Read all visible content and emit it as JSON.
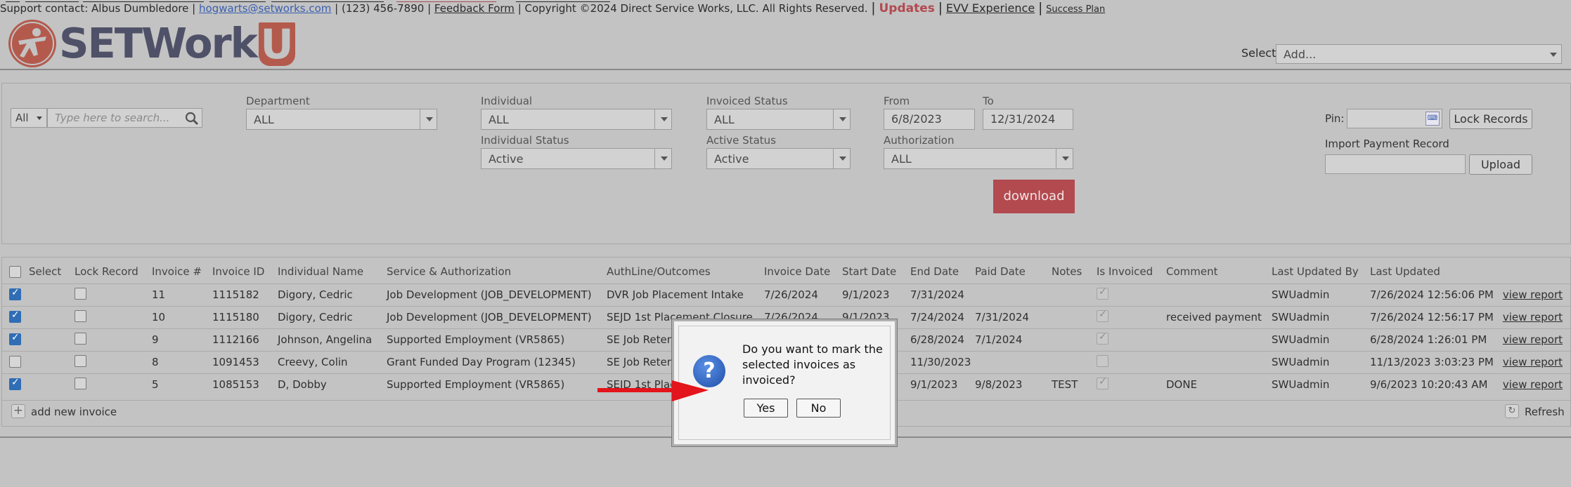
{
  "brand": {
    "logo_text": "SETWorks",
    "logo_u": "U",
    "colors": {
      "brand_red": "#b35a4d",
      "brand_slate": "#4f5168",
      "download_bg": "#b24a50"
    }
  },
  "header": {
    "select_label": "Select:",
    "select_value": "Add..."
  },
  "filters": {
    "search_scope": "All",
    "search_placeholder": "Type here to search...",
    "department": {
      "label": "Department",
      "value": "ALL"
    },
    "individual": {
      "label": "Individual",
      "value": "ALL"
    },
    "individual_status": {
      "label": "Individual Status",
      "value": "Active"
    },
    "invoiced_status": {
      "label": "Invoiced Status",
      "value": "ALL"
    },
    "active_status": {
      "label": "Active Status",
      "value": "Active"
    },
    "from": {
      "label": "From",
      "value": "6/8/2023"
    },
    "to": {
      "label": "To",
      "value": "12/31/2024"
    },
    "authorization": {
      "label": "Authorization",
      "value": "ALL"
    },
    "download_label": "download",
    "pin_label": "Pin:",
    "lock_records_label": "Lock Records",
    "import_label": "Import Payment Record",
    "upload_label": "Upload"
  },
  "grid": {
    "headers": [
      "Select",
      "Lock Record",
      "Invoice #",
      "Invoice ID",
      "Individual Name",
      "Service & Authorization",
      "AuthLine/Outcomes",
      "Invoice Date",
      "Start Date",
      "End Date",
      "Paid Date",
      "Notes",
      "Is Invoiced",
      "Comment",
      "Last Updated By",
      "Last Updated"
    ],
    "rows": [
      {
        "selected": true,
        "locked": false,
        "invoice_no": "11",
        "invoice_id": "1115182",
        "name": "Digory, Cedric",
        "service": "Job Development (JOB_DEVELOPMENT)",
        "authline": "DVR Job Placement Intake",
        "invoice_date": "7/26/2024",
        "start": "9/1/2023",
        "end": "7/31/2024",
        "paid": "",
        "notes": "",
        "invoiced": true,
        "comment": "",
        "updated_by": "SWUadmin",
        "updated": "7/26/2024 12:56:06 PM",
        "link": "view report"
      },
      {
        "selected": true,
        "locked": false,
        "invoice_no": "10",
        "invoice_id": "1115180",
        "name": "Digory, Cedric",
        "service": "Job Development (JOB_DEVELOPMENT)",
        "authline": "SEJD 1st Placement Closure",
        "invoice_date": "7/26/2024",
        "start": "9/1/2023",
        "end": "7/24/2024",
        "paid": "7/31/2024",
        "notes": "",
        "invoiced": true,
        "comment": "received payment",
        "updated_by": "SWUadmin",
        "updated": "7/26/2024 12:56:17 PM",
        "link": "view report"
      },
      {
        "selected": true,
        "locked": false,
        "invoice_no": "9",
        "invoice_id": "1112166",
        "name": "Johnson, Angelina",
        "service": "Supported Employment (VR5865)",
        "authline": "SE Job Retent",
        "invoice_date": "",
        "start": "",
        "end": "6/28/2024",
        "paid": "7/1/2024",
        "notes": "",
        "invoiced": true,
        "comment": "",
        "updated_by": "SWUadmin",
        "updated": "6/28/2024 1:26:01 PM",
        "link": "view report"
      },
      {
        "selected": false,
        "locked": false,
        "invoice_no": "8",
        "invoice_id": "1091453",
        "name": "Creevy, Colin",
        "service": "Grant Funded Day Program (12345)",
        "authline": "SE Job Retent",
        "invoice_date": "",
        "start": "",
        "end": "11/30/2023",
        "paid": "",
        "notes": "",
        "invoiced": false,
        "comment": "",
        "updated_by": "SWUadmin",
        "updated": "11/13/2023 3:03:23 PM",
        "link": "view report"
      },
      {
        "selected": true,
        "locked": false,
        "invoice_no": "5",
        "invoice_id": "1085153",
        "name": "D, Dobby",
        "service": "Supported Employment (VR5865)",
        "authline": "SEJD 1st Plac",
        "invoice_date": "",
        "start": "",
        "end": "9/1/2023",
        "paid": "9/8/2023",
        "notes": "TEST",
        "invoiced": true,
        "comment": "DONE",
        "updated_by": "SWUadmin",
        "updated": "9/6/2023 10:20:43 AM",
        "link": "view report"
      }
    ],
    "add_label": "add new invoice",
    "refresh_label": "Refresh"
  },
  "footer": {
    "support": "Support contact: Albus Dumbledore |",
    "email": "hogwarts@setworks.com",
    "phone": "| (123) 456-7890 |",
    "feedback": "Feedback Form",
    "copyright": "| Copyright ©2024 Direct Service Works, LLC. All Rights Reserved.",
    "sep": "|",
    "updates": "Updates",
    "evv": "EVV Experience",
    "success": "Success Plan"
  },
  "dialog": {
    "icon": "question-icon",
    "message": "Do you want to mark the selected invoices as invoiced?",
    "yes": "Yes",
    "no": "No"
  }
}
